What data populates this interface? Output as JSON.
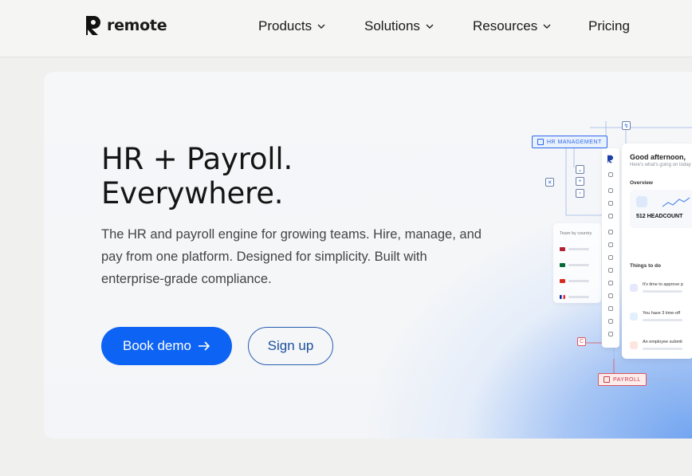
{
  "header": {
    "logo_text": "remote",
    "nav": [
      {
        "label": "Products",
        "has_dropdown": true
      },
      {
        "label": "Solutions",
        "has_dropdown": true
      },
      {
        "label": "Resources",
        "has_dropdown": true
      },
      {
        "label": "Pricing",
        "has_dropdown": false
      }
    ]
  },
  "hero": {
    "title_line1": "HR + Payroll.",
    "title_line2": "Everywhere.",
    "subtitle": "The HR and payroll engine for growing teams. Hire, manage, and pay from one platform. Designed for simplicity. Built with enterprise-grade compliance.",
    "primary_button": "Book demo",
    "secondary_button": "Sign up"
  },
  "illustration": {
    "hr_tag": "HR MANAGEMENT",
    "payroll_tag": "PAYROLL",
    "greeting": "Good afternoon,",
    "greeting_sub": "Here's what's going on today",
    "overview": "Overview",
    "headcount": "512 HEADCOUNT",
    "team_by_country": "Team by country",
    "countries": [
      "United States",
      "Portugal",
      "Canada",
      "France"
    ],
    "things_to_do": "Things to do",
    "todos": [
      "It's time to approve p",
      "You have 3 time-off",
      "An employee submit"
    ]
  },
  "colors": {
    "primary": "#0d63f3",
    "secondary_border": "#2a5db0",
    "background": "#f0f0ef",
    "hr_accent": "#2a6ae8",
    "payroll_accent": "#e0555f"
  }
}
